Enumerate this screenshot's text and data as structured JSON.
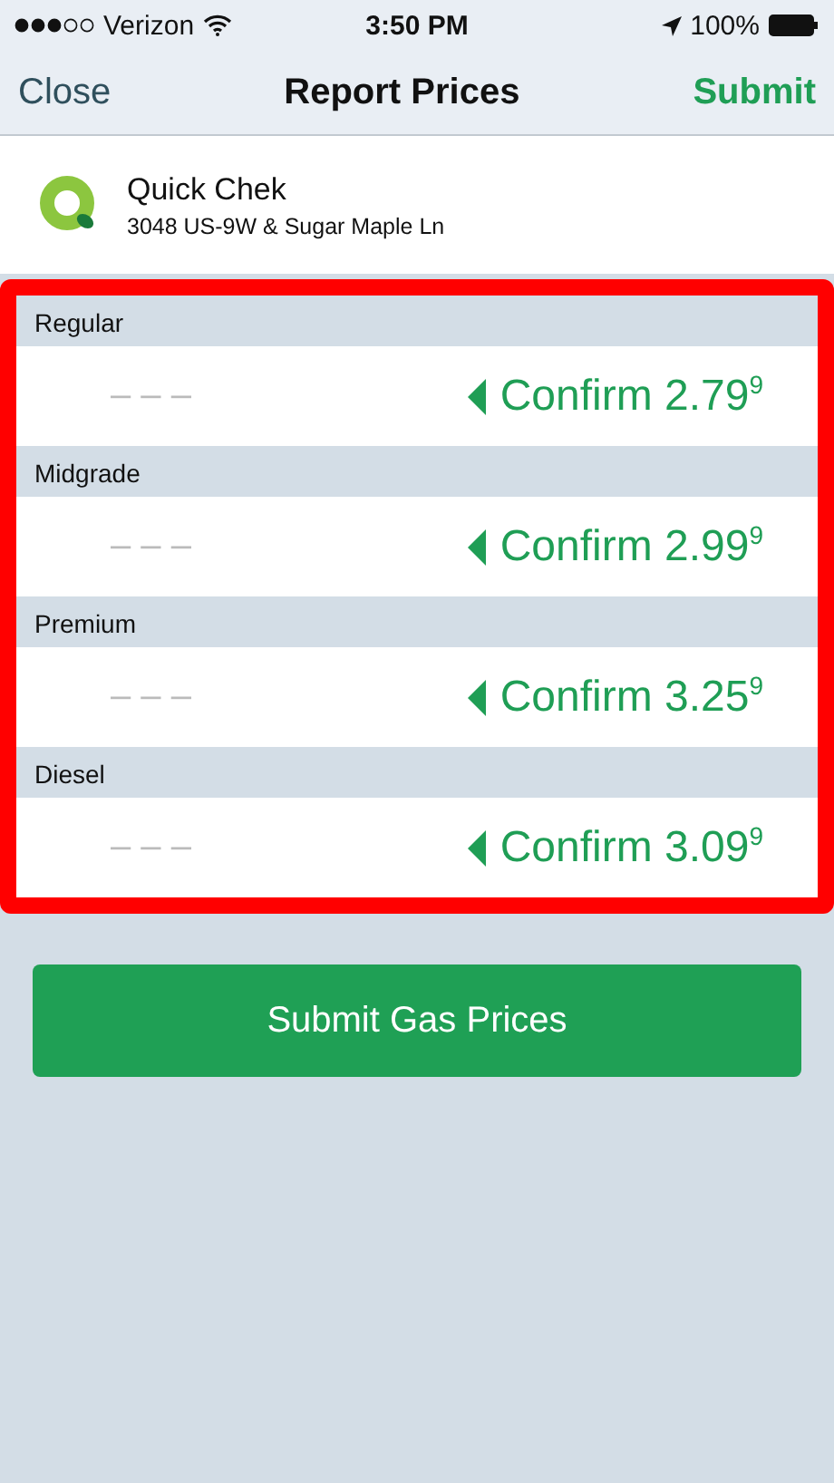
{
  "status_bar": {
    "carrier": "Verizon",
    "time": "3:50 PM",
    "battery": "100%"
  },
  "nav": {
    "left": "Close",
    "title": "Report Prices",
    "right": "Submit"
  },
  "station": {
    "name": "Quick Chek",
    "address": "3048 US-9W & Sugar Maple Ln"
  },
  "grades": [
    {
      "label": "Regular",
      "placeholder": "– – –",
      "confirm": "Confirm 2.79$^{9}$"
    },
    {
      "label": "Midgrade",
      "placeholder": "– – –",
      "confirm": "Confirm 2.99$^{9}$"
    },
    {
      "label": "Premium",
      "placeholder": "– – –",
      "confirm": "Confirm 3.25$^{9}$"
    },
    {
      "label": "Diesel",
      "placeholder": "– – –",
      "confirm": "Confirm 3.09$^{9}$"
    }
  ],
  "submit_button": "Submit Gas Prices"
}
